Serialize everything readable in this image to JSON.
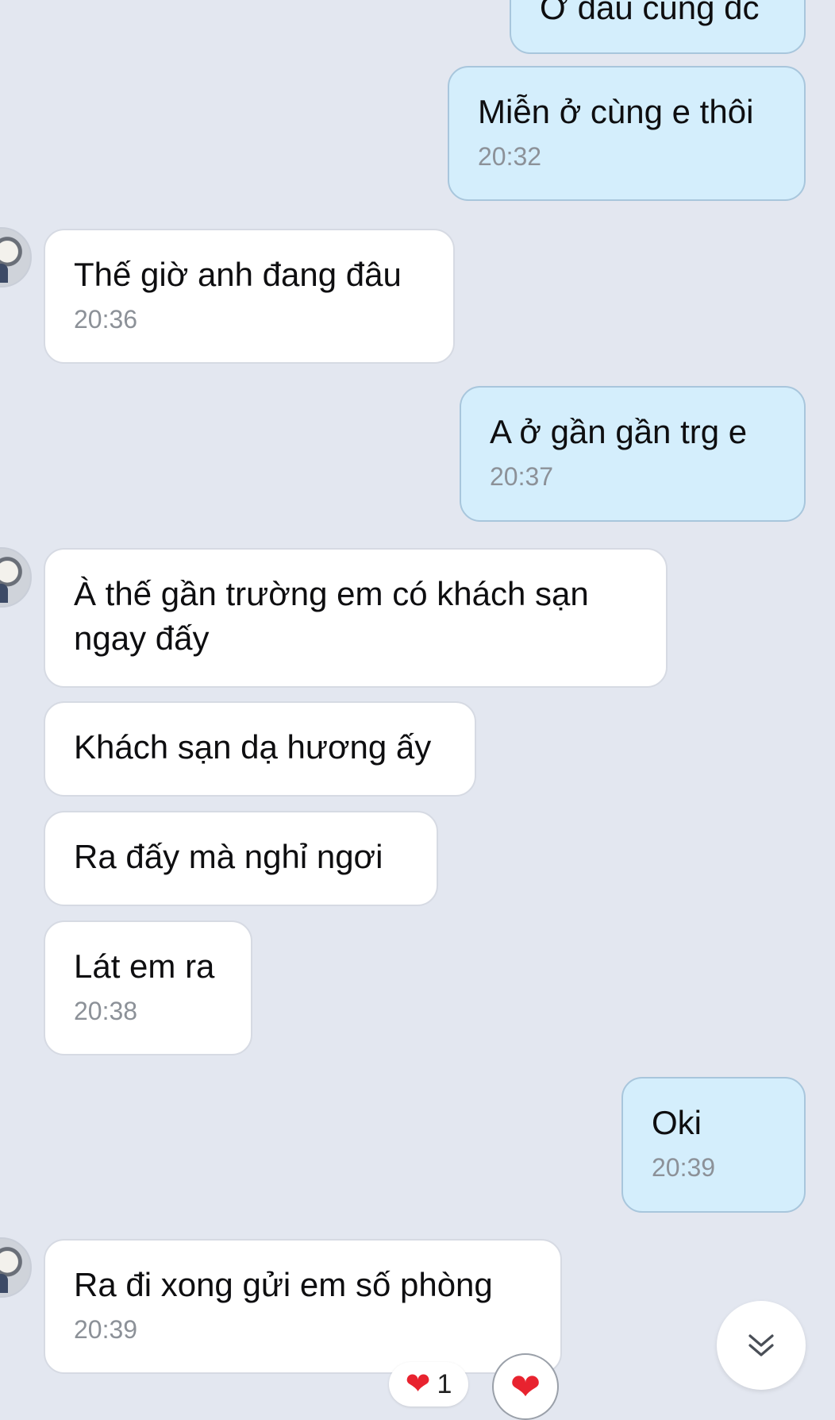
{
  "messages": [
    {
      "text": "Ở đâu cũng dc",
      "time": ""
    },
    {
      "text": "Miễn ở cùng e thôi",
      "time": "20:32"
    },
    {
      "text": "Thế giờ anh đang đâu",
      "time": "20:36"
    },
    {
      "text": "A ở gần gần trg e",
      "time": "20:37"
    },
    {
      "text": "À thế gần trường em có khách sạn ngay đấy",
      "time": ""
    },
    {
      "text": "Khách sạn dạ hương ấy",
      "time": ""
    },
    {
      "text": "Ra đấy mà nghỉ ngơi",
      "time": ""
    },
    {
      "text": "Lát em ra",
      "time": "20:38"
    },
    {
      "text": "Oki",
      "time": "20:39"
    },
    {
      "text": "Ra đi xong gửi em số phòng",
      "time": "20:39"
    }
  ],
  "reaction": {
    "icon": "heart-icon",
    "count": "1"
  },
  "react_button_icon": "heart-icon",
  "scroll_button_icon": "double-chevron-down-icon",
  "colors": {
    "background": "#e3e7f0",
    "incoming_bubble": "#ffffff",
    "outgoing_bubble": "#d4eefc",
    "outgoing_border": "#a8c6dc",
    "timestamp": "#8c9198",
    "heart": "#e8232f"
  }
}
